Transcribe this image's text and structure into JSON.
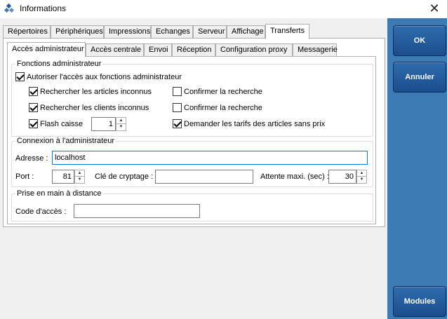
{
  "window": {
    "title": "Informations",
    "close_icon": "close-icon",
    "app_icon": "app-icon"
  },
  "main_tabs": [
    "Répertoires",
    "Périphériques",
    "Impressions",
    "Echanges",
    "Serveur",
    "Affichage",
    "Transferts"
  ],
  "main_tabs_active": "Transferts",
  "sub_tabs": [
    "Accès administrateur",
    "Accès centrale",
    "Envoi",
    "Réception",
    "Configuration proxy",
    "Messagerie"
  ],
  "sub_tabs_active": "Accès administrateur",
  "fonctions": {
    "title": "Fonctions administrateur",
    "autoriser": {
      "label": "Autoriser l'accès aux fonctions administrateur",
      "checked": true
    },
    "rechercher_articles": {
      "label": "Rechercher les articles inconnus",
      "checked": true
    },
    "confirmer_articles": {
      "label": "Confirmer la recherche",
      "checked": false
    },
    "rechercher_clients": {
      "label": "Rechercher les clients inconnus",
      "checked": true
    },
    "confirmer_clients": {
      "label": "Confirmer la recherche",
      "checked": false
    },
    "flash_caisse": {
      "label": "Flash caisse",
      "checked": true,
      "value": "1"
    },
    "demander_tarifs": {
      "label": "Demander les tarifs des articles sans prix",
      "checked": true
    }
  },
  "connexion": {
    "title": "Connexion à l'administrateur",
    "adresse_label": "Adresse :",
    "adresse_value": "localhost",
    "port_label": "Port :",
    "port_value": "81",
    "cle_label": "Clé de cryptage :",
    "cle_value": "",
    "attente_label": "Attente maxi. (sec) :",
    "attente_value": "30"
  },
  "prise": {
    "title": "Prise en main à distance",
    "code_label": "Code d'accès :",
    "code_value": ""
  },
  "buttons": {
    "ok": "OK",
    "annuler": "Annuler",
    "modules": "Modules"
  },
  "colors": {
    "side_panel": "#3c7ab5",
    "button": "#1f5595",
    "focus_border": "#0078d7"
  }
}
